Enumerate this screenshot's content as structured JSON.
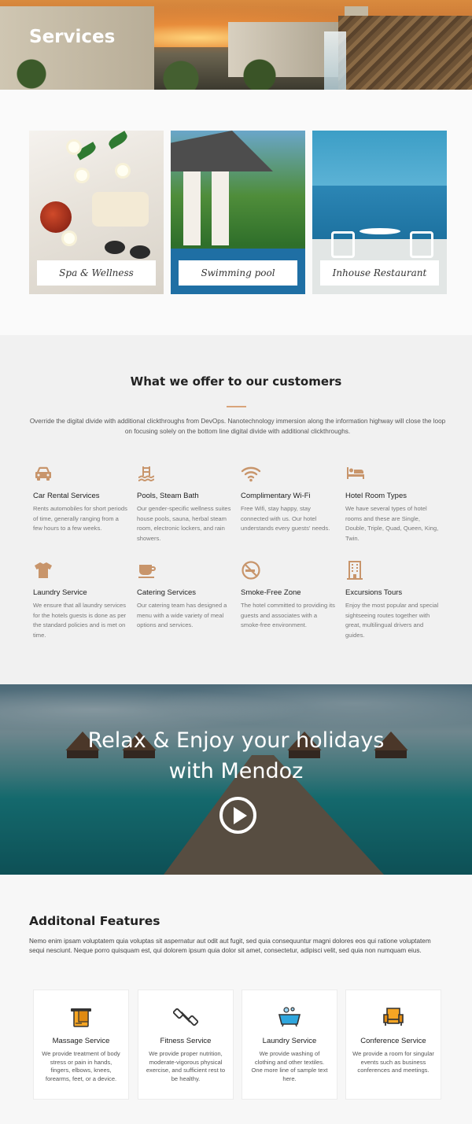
{
  "hero": {
    "title": "Services"
  },
  "cards": [
    {
      "label": "Spa & Wellness"
    },
    {
      "label": "Swimming pool"
    },
    {
      "label": "Inhouse Restaurant"
    }
  ],
  "offer": {
    "title": "What we offer to our customers",
    "description": "Override the digital divide with additional clickthroughs from DevOps. Nanotechnology immersion along the information highway will close the loop on focusing solely on the bottom line digital divide with additional clickthroughs.",
    "services": [
      {
        "icon": "car-icon",
        "title": "Car Rental Services",
        "desc": "Rents automobiles for short periods of time, generally ranging from a few hours to a few weeks."
      },
      {
        "icon": "pool-icon",
        "title": "Pools, Steam Bath",
        "desc": "Our gender-specific wellness suites house pools, sauna, herbal steam room, electronic lockers, and rain showers."
      },
      {
        "icon": "wifi-icon",
        "title": "Complimentary Wi-Fi",
        "desc": "Free Wifi, stay happy, stay connected with us. Our hotel understands every guests' needs."
      },
      {
        "icon": "bed-icon",
        "title": "Hotel Room Types",
        "desc": "We have several types of hotel rooms and these are Single, Double, Triple, Quad, Queen, King, Twin."
      },
      {
        "icon": "shirt-icon",
        "title": "Laundry Service",
        "desc": "We ensure that all laundry services for the hotels guests is done as per the standard policies and is met on time."
      },
      {
        "icon": "coffee-cup-icon",
        "title": "Catering Services",
        "desc": "Our catering team has designed a menu with a wide variety of meal options and services."
      },
      {
        "icon": "no-smoking-icon",
        "title": "Smoke-Free Zone",
        "desc": "The hotel committed to providing its guests and associates with a smoke-free environment."
      },
      {
        "icon": "building-icon",
        "title": "Excursions Tours",
        "desc": "Enjoy the most popular and special sightseeing routes together with great, multilingual drivers and guides."
      }
    ]
  },
  "banner": {
    "line1": "Relax & Enjoy your holidays",
    "line2": "with Mendoz"
  },
  "features": {
    "title": "Additonal Features",
    "description": "Nemo enim ipsam voluptatem quia voluptas sit aspernatur aut odit aut fugit, sed quia consequuntur magni dolores eos qui ratione voluptatem sequi nesciunt. Neque porro quisquam est, qui dolorem ipsum quia dolor sit amet, consectetur, adipisci velit, sed quia non numquam eius.",
    "items": [
      {
        "icon": "towel-icon",
        "title": "Massage Service",
        "desc": "We provide treatment of body stress or pain in hands, fingers, elbows, knees, forearms, feet, or a device."
      },
      {
        "icon": "dumbbell-icon",
        "title": "Fitness Service",
        "desc": "We provide proper nutrition, moderate-vigorous physical exercise, and sufficient rest to be healthy."
      },
      {
        "icon": "washing-tub-icon",
        "title": "Laundry Service",
        "desc": "We provide washing of clothing and other textiles. One more line of sample text here."
      },
      {
        "icon": "armchair-icon",
        "title": "Conference Service",
        "desc": "We provide a room for singular events such as business conferences and meetings."
      }
    ]
  },
  "colors": {
    "accent": "#c8956b",
    "heading": "#222222"
  }
}
